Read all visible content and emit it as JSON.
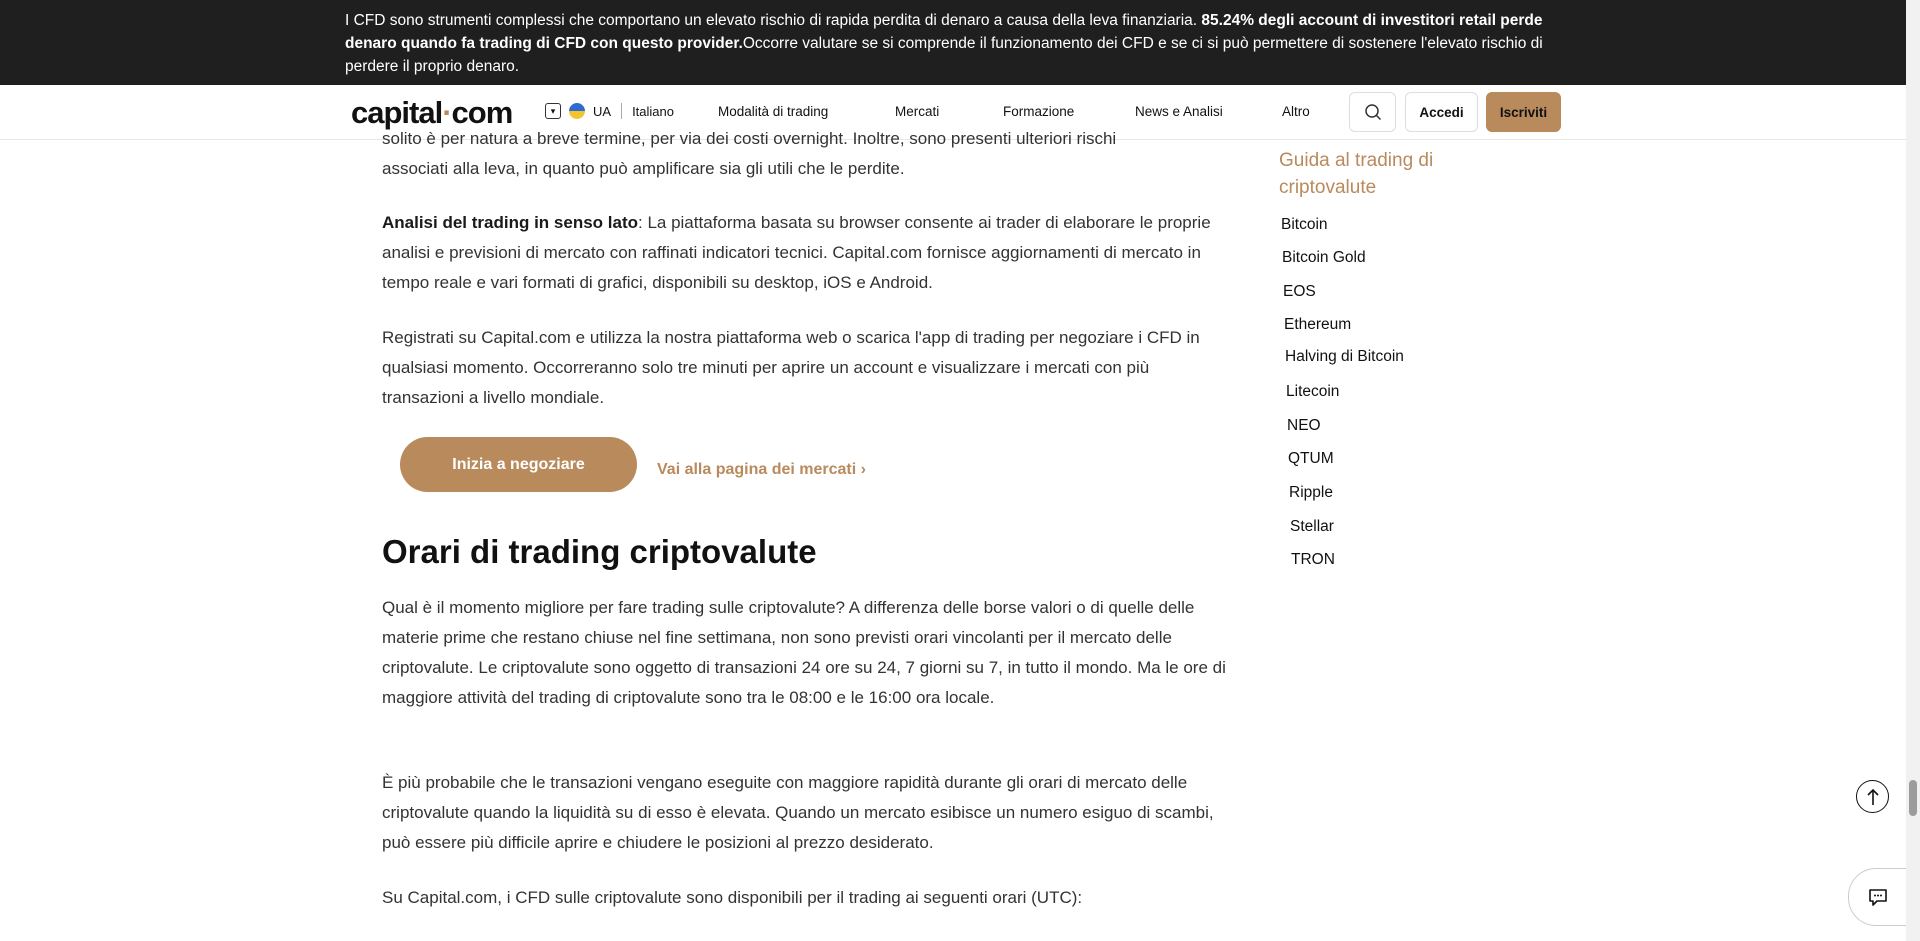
{
  "risk_banner": {
    "text_1": "I CFD sono strumenti complessi che comportano un elevato rischio di rapida perdita di denaro a causa della leva finanziaria. ",
    "bold": "85.24% degli account di investitori retail perde denaro quando fa trading di CFD con questo provider.",
    "text_2": "Occorre valutare se si comprende il funzionamento dei CFD e se ci si può permettere di sostenere l'elevato rischio di perdere il proprio denaro."
  },
  "header": {
    "logo": "capital",
    "logo_dot": "·",
    "logo_tld": "com",
    "region": "UA",
    "language": "Italiano",
    "nav": [
      "Modalità di trading",
      "Mercati",
      "Formazione",
      "News e Analisi",
      "Altro"
    ],
    "login": "Accedi",
    "signup": "Iscriviti"
  },
  "content": {
    "partial_para": "solito è per natura a breve termine, per via dei costi overnight. Inoltre, sono presenti ulteriori rischi",
    "partial_para_2": "associati alla leva, in quanto può amplificare sia gli utili che le perdite.",
    "analysis_bold": "Analisi del trading in senso lato",
    "analysis_text": ": La piattaforma basata su browser consente ai trader di elaborare le proprie analisi e previsioni di mercato con raffinati indicatori tecnici. Capital.com fornisce aggiornamenti di mercato in tempo reale e vari formati di grafici, disponibili su desktop, iOS e Android.",
    "register_para": "Registrati su Capital.com e utilizza la nostra piattaforma web o scarica l'app di trading per negoziare i CFD in qualsiasi momento. Occorreranno solo tre minuti per aprire un account e visualizzare i mercati con più transazioni a livello mondiale.",
    "cta": "Inizia a negoziare",
    "markets_link": "Vai alla pagina dei mercati",
    "heading": "Orari di trading criptovalute",
    "hours_para": "Qual è il momento migliore per fare trading sulle criptovalute? A differenza delle borse valori o di quelle delle materie prime che restano chiuse nel fine settimana, non sono previsti orari vincolanti per il mercato delle criptovalute. Le criptovalute sono oggetto di transazioni 24 ore su 24, 7 giorni su 7, in tutto il mondo. Ma le ore di maggiore attività del trading di criptovalute sono tra le 08:00 e le 16:00 ora locale.",
    "liquidity_para": "È più probabile che le transazioni vengano eseguite con maggiore rapidità durante gli orari di mercato delle criptovalute quando la liquidità su di esso è elevata. Quando un mercato esibisce un numero esiguo di scambi, può essere più difficile aprire e chiudere le posizioni al prezzo desiderato.",
    "utc_para": "Su Capital.com, i CFD sulle criptovalute sono disponibili per il trading ai seguenti orari (UTC):"
  },
  "sidebar": {
    "title": "Guida al trading di criptovalute",
    "items": [
      "Bitcoin",
      "Bitcoin Gold",
      "EOS",
      "Ethereum",
      "Halving di Bitcoin",
      "Litecoin",
      "NEO",
      "QTUM",
      "Ripple",
      "Stellar",
      "TRON"
    ]
  },
  "colors": {
    "accent": "#b98a5c",
    "banner_bg": "#1f1f1f"
  }
}
